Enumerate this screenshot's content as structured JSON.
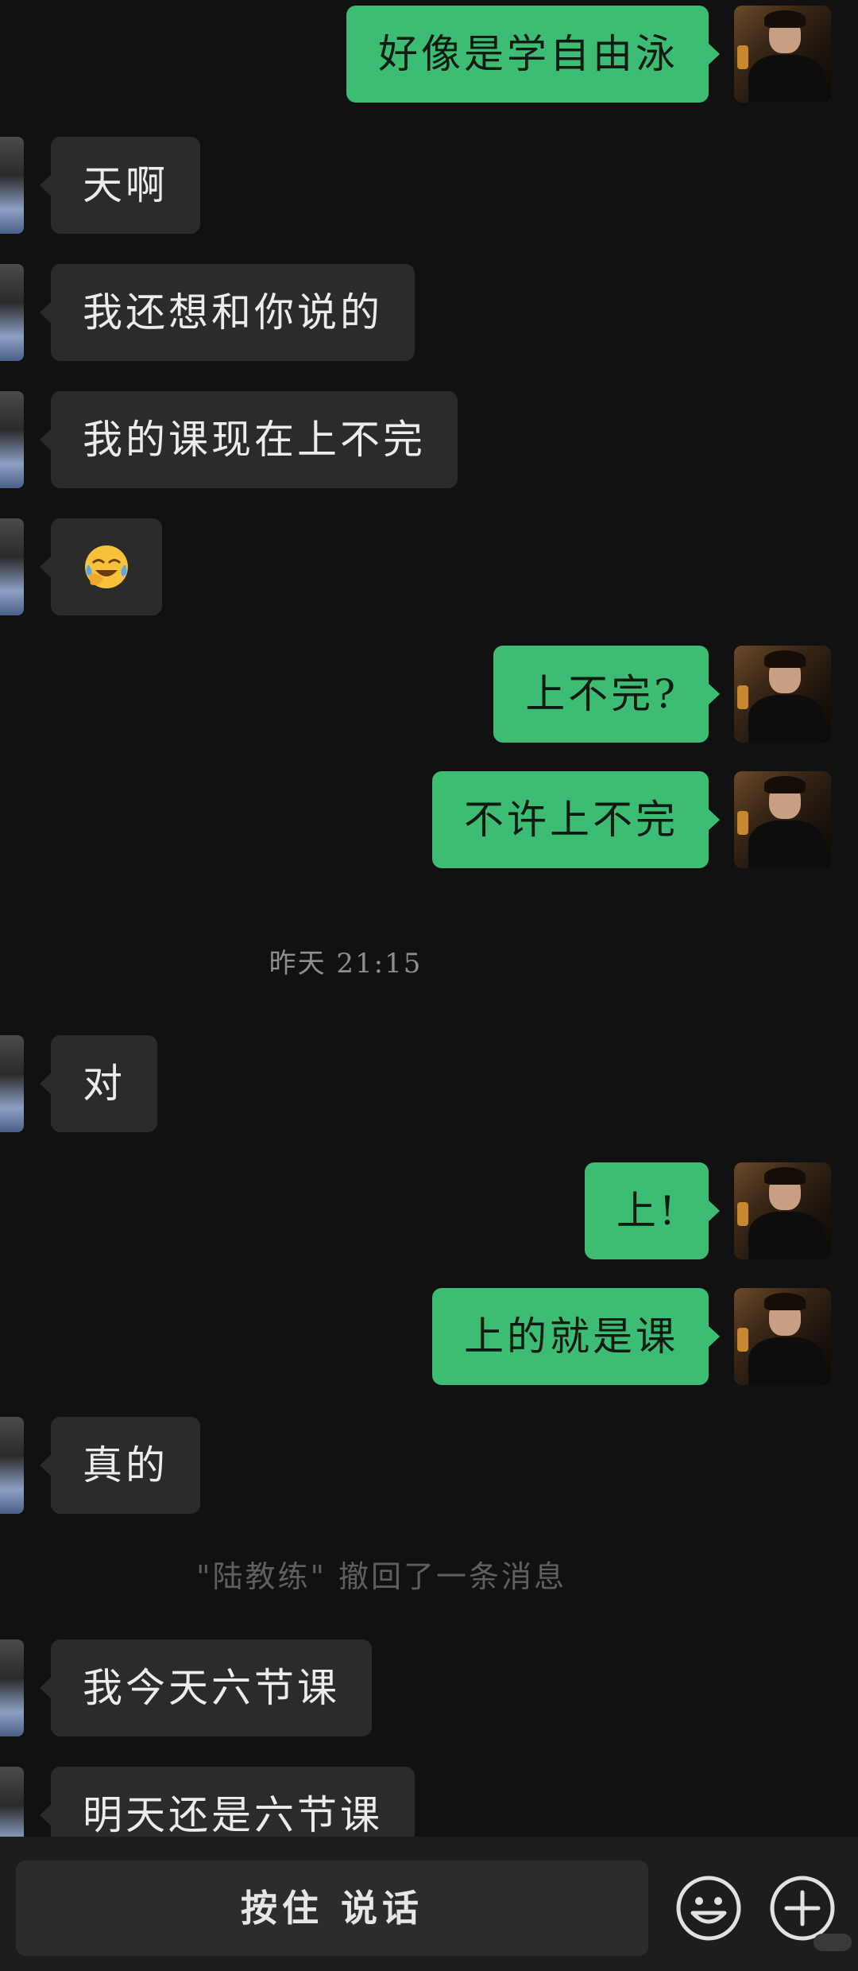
{
  "messages": [
    {
      "side": "out",
      "text": "好像是学自由泳"
    },
    {
      "side": "in",
      "text": "天啊"
    },
    {
      "side": "in",
      "text": "我还想和你说的"
    },
    {
      "side": "in",
      "text": "我的课现在上不完"
    },
    {
      "side": "in",
      "emoji": "face-with-tears-of-joy-hand"
    },
    {
      "side": "out",
      "text": "上不完?"
    },
    {
      "side": "out",
      "text": "不许上不完"
    },
    {
      "timestamp": "昨天 21:15"
    },
    {
      "side": "in",
      "text": "对"
    },
    {
      "side": "out",
      "text": "上!"
    },
    {
      "side": "out",
      "text": "上的就是课"
    },
    {
      "side": "in",
      "text": "真的"
    },
    {
      "system": "\"陆教练\" 撤回了一条消息"
    },
    {
      "side": "in",
      "text": "我今天六节课"
    },
    {
      "side": "in",
      "text": "明天还是六节课"
    }
  ],
  "input_bar": {
    "hold_to_talk_label": "按住 说话",
    "emoji_button_icon": "smiley-icon",
    "more_button_icon": "plus-circle-icon"
  },
  "colors": {
    "background": "#111111",
    "outgoing_bubble": "#3dbd74",
    "incoming_bubble": "#2b2b2b"
  }
}
